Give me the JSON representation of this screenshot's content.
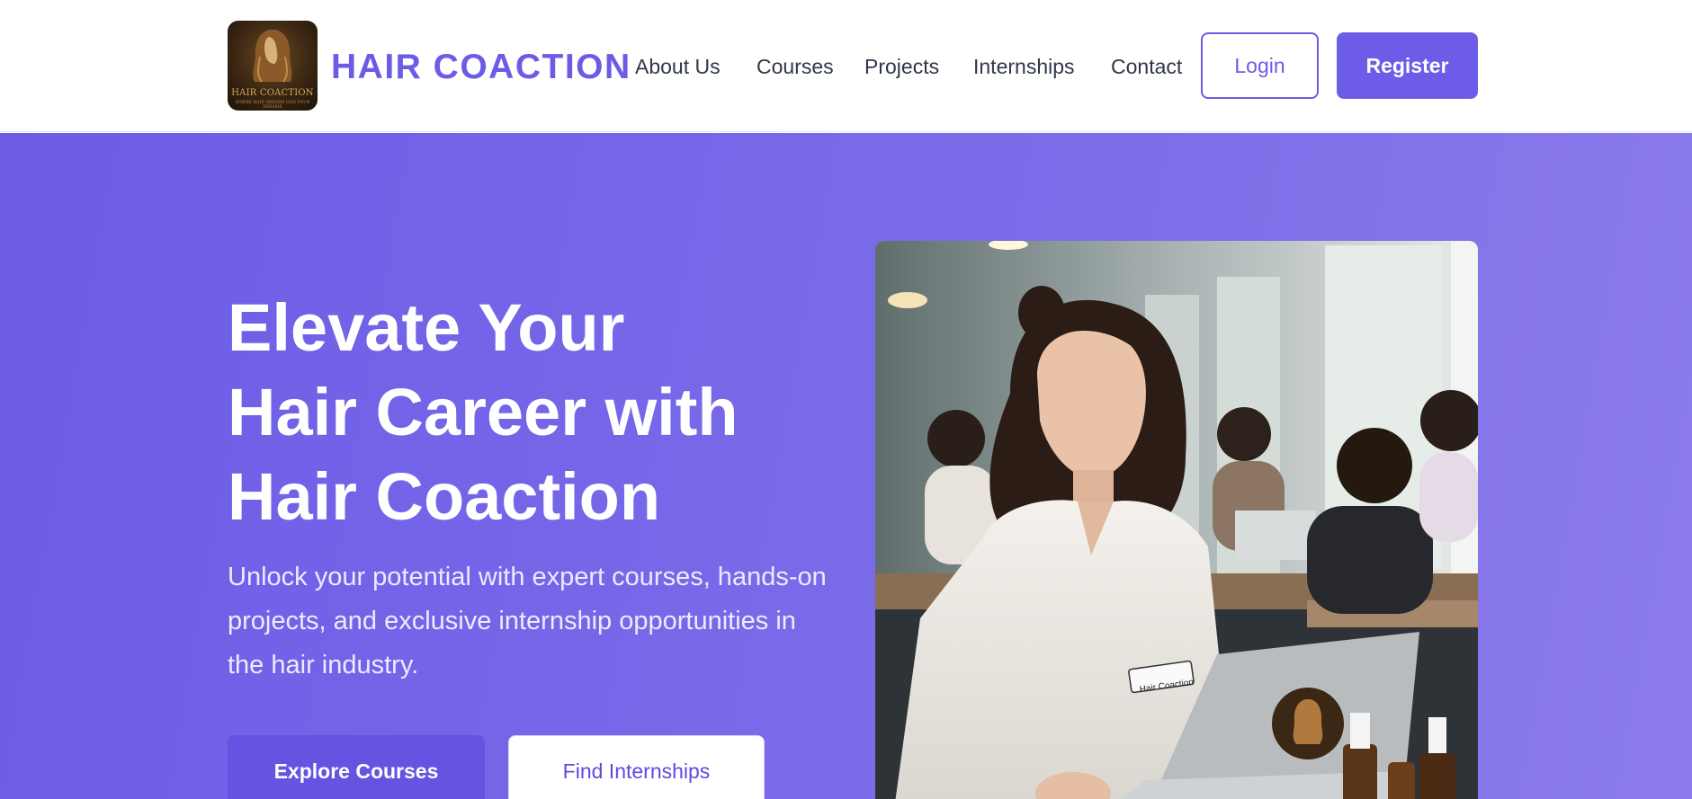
{
  "header": {
    "logo": {
      "icon": "hair-woman-logo-icon",
      "line1": "HAIR COACTION",
      "line2": "WHERE HAIR DREAMS LIVE YOUR DREAMS"
    },
    "brand": "HAIR COACTION",
    "nav": [
      "About Us",
      "Courses",
      "Projects",
      "Internships",
      "Contact"
    ],
    "login_label": "Login",
    "register_label": "Register"
  },
  "hero": {
    "title_lines": [
      "Elevate Your",
      "Hair Career with",
      "Hair Coaction"
    ],
    "subtitle": "Unlock your potential with expert courses, hands-on projects, and exclusive internship opportunities in the hair industry.",
    "primary_cta": "Explore Courses",
    "secondary_cta": "Find Internships",
    "image": {
      "subject": "student-studying-on-laptop-photo",
      "name_badge": "Hair Coaction"
    }
  },
  "colors": {
    "brand": "#6b5be6",
    "hero_start": "#6d5ce6",
    "hero_end": "#8b7bea",
    "text_dark": "#2f3747"
  }
}
